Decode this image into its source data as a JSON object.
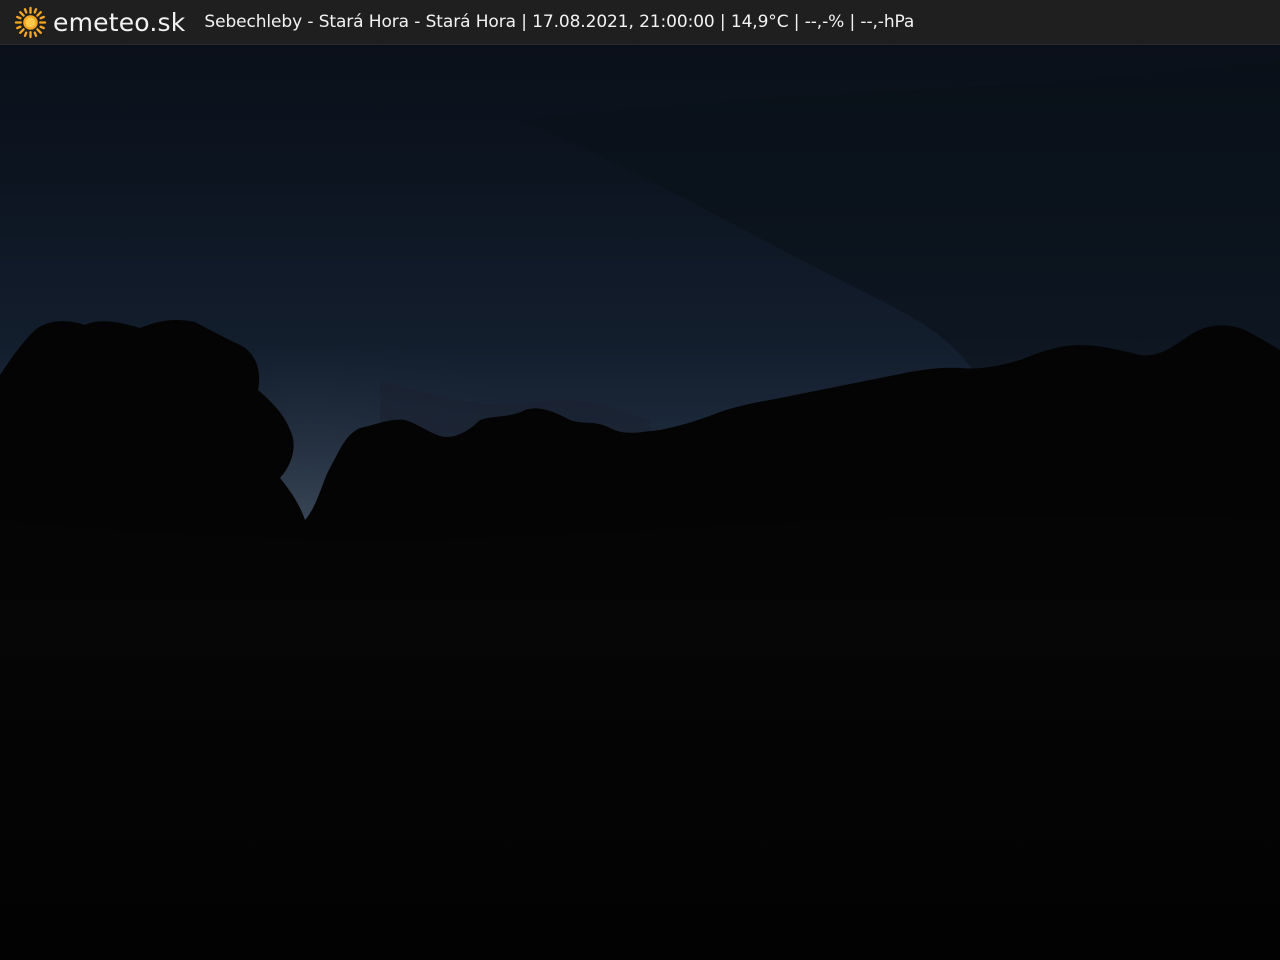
{
  "header": {
    "brand": "emeteo.sk",
    "logo_icon": "sun-icon",
    "station_info": "Sebechleby - Stará Hora - Stará Hora | 17.08.2021, 21:00:00 | 14,9°C | --,-% | --,-hPa"
  },
  "scene": {
    "description_colors": {
      "sky_top": "#0b121c",
      "sky_horizon": "#2a3a4d",
      "ground": "#030303",
      "accent_sun": "#f5a623"
    }
  }
}
